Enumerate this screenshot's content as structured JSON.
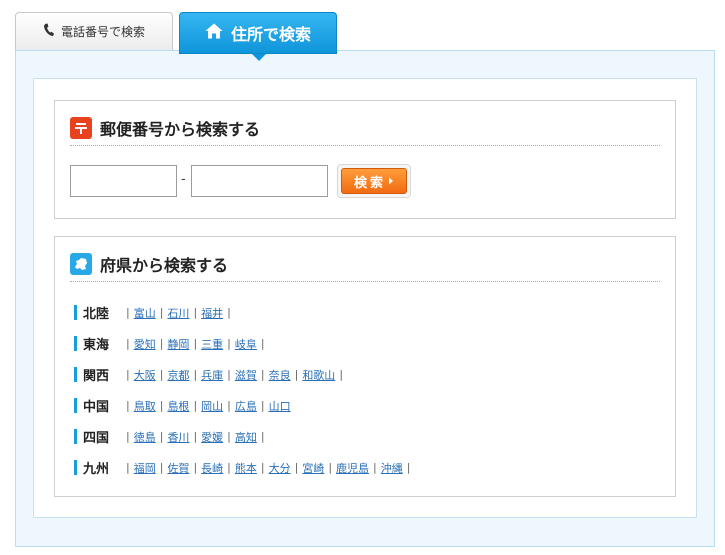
{
  "tabs": {
    "phone_label": "電話番号で検索",
    "address_label": "住所で検索"
  },
  "postal": {
    "title": "郵便番号から検索する",
    "dash": "-",
    "search_label": "検索"
  },
  "prefecture": {
    "title": "府県から検索する",
    "regions": [
      {
        "name": "北陸",
        "prefectures": [
          "富山",
          "石川",
          "福井"
        ]
      },
      {
        "name": "東海",
        "prefectures": [
          "愛知",
          "静岡",
          "三重",
          "岐阜"
        ]
      },
      {
        "name": "関西",
        "prefectures": [
          "大阪",
          "京都",
          "兵庫",
          "滋賀",
          "奈良",
          "和歌山"
        ]
      },
      {
        "name": "中国",
        "prefectures": [
          "鳥取",
          "島根",
          "岡山",
          "広島",
          "山口"
        ]
      },
      {
        "name": "四国",
        "prefectures": [
          "徳島",
          "香川",
          "愛媛",
          "高知"
        ]
      },
      {
        "name": "九州",
        "prefectures": [
          "福岡",
          "佐賀",
          "長崎",
          "熊本",
          "大分",
          "宮崎",
          "鹿児島",
          "沖縄"
        ]
      }
    ]
  },
  "colors": {
    "accent_blue": "#0f95da",
    "search_orange": "#f26b12",
    "link_blue": "#2a6fb7",
    "postal_red": "#e8421f"
  },
  "icons": {
    "phone": "phone-icon",
    "home": "home-icon",
    "postal": "postal-mark-icon",
    "map": "map-icon",
    "arrow": "arrow-right-icon"
  }
}
